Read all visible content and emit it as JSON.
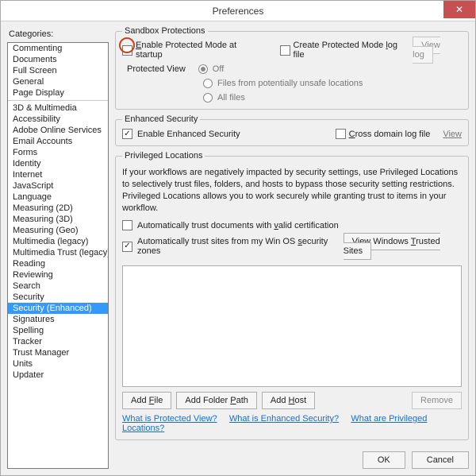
{
  "window": {
    "title": "Preferences",
    "close_glyph": "✕"
  },
  "categories_label": "Categories:",
  "categories": {
    "group1": [
      "Commenting",
      "Documents",
      "Full Screen",
      "General",
      "Page Display"
    ],
    "group2": [
      "3D & Multimedia",
      "Accessibility",
      "Adobe Online Services",
      "Email Accounts",
      "Forms",
      "Identity",
      "Internet",
      "JavaScript",
      "Language",
      "Measuring (2D)",
      "Measuring (3D)",
      "Measuring (Geo)",
      "Multimedia (legacy)",
      "Multimedia Trust (legacy)",
      "Reading",
      "Reviewing",
      "Search",
      "Security",
      "Security (Enhanced)",
      "Signatures",
      "Spelling",
      "Tracker",
      "Trust Manager",
      "Units",
      "Updater"
    ],
    "selected": "Security (Enhanced)"
  },
  "sandbox": {
    "legend": "Sandbox Protections",
    "protected_mode": "Enable Protected Mode at startup",
    "create_log": "Create Protected Mode log file",
    "view_log": "View log",
    "protected_view_label": "Protected View",
    "off": "Off",
    "unsafe": "Files from potentially unsafe locations",
    "allfiles": "All files"
  },
  "enhanced": {
    "legend": "Enhanced Security",
    "enable": "Enable Enhanced Security",
    "cross": "Cross domain log file",
    "view": "View"
  },
  "priv": {
    "legend": "Privileged Locations",
    "desc": "If your workflows are negatively impacted by security settings, use Privileged Locations to selectively trust files, folders, and hosts to bypass those security setting restrictions. Privileged Locations allows you to work securely while granting trust to items in your workflow.",
    "auto_valid": "Automatically trust documents with valid certification",
    "auto_os": "Automatically trust sites from my Win OS security zones",
    "view_trusted": "View Windows Trusted Sites",
    "add_file": "Add File",
    "add_folder": "Add Folder Path",
    "add_host": "Add Host",
    "remove": "Remove"
  },
  "links": {
    "q1": "What is Protected View?",
    "q2": "What is Enhanced Security?",
    "q3": "What are Privileged Locations?"
  },
  "footer": {
    "ok": "OK",
    "cancel": "Cancel"
  }
}
